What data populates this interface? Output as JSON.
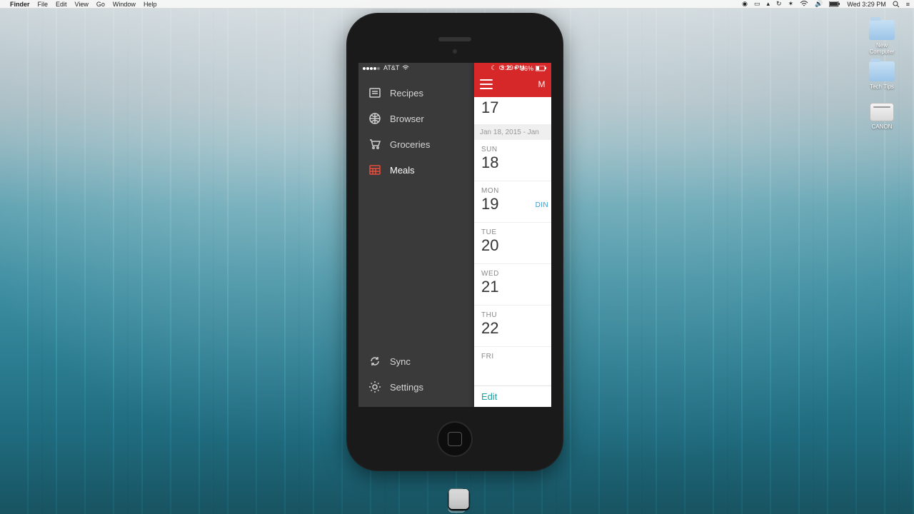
{
  "mac": {
    "app_name": "Finder",
    "menus": [
      "File",
      "Edit",
      "View",
      "Go",
      "Window",
      "Help"
    ],
    "clock": "Wed 3:29 PM",
    "desktop_icons": [
      {
        "label": "New Computer",
        "kind": "folder"
      },
      {
        "label": "Tech Tips",
        "kind": "folder"
      },
      {
        "label": "CANON",
        "kind": "drive"
      }
    ]
  },
  "ios_status": {
    "carrier": "AT&T",
    "time": "3:29 PM",
    "battery_pct": "36%"
  },
  "sidebar": {
    "items": [
      {
        "label": "Recipes"
      },
      {
        "label": "Browser"
      },
      {
        "label": "Groceries"
      },
      {
        "label": "Meals"
      }
    ],
    "bottom": [
      {
        "label": "Sync"
      },
      {
        "label": "Settings"
      }
    ]
  },
  "panel": {
    "header_right": "M",
    "top_day_num": "17",
    "week_header": "Jan 18, 2015 - Jan",
    "days": [
      {
        "dow": "SUN",
        "num": "18",
        "meal": ""
      },
      {
        "dow": "MON",
        "num": "19",
        "meal": "DIN"
      },
      {
        "dow": "TUE",
        "num": "20",
        "meal": ""
      },
      {
        "dow": "WED",
        "num": "21",
        "meal": ""
      },
      {
        "dow": "THU",
        "num": "22",
        "meal": ""
      },
      {
        "dow": "FRI",
        "num": "",
        "meal": ""
      }
    ],
    "edit_label": "Edit"
  },
  "colors": {
    "accent": "#d62828",
    "sidebar": "#3a3a3a",
    "teal": "#17a2a2"
  }
}
